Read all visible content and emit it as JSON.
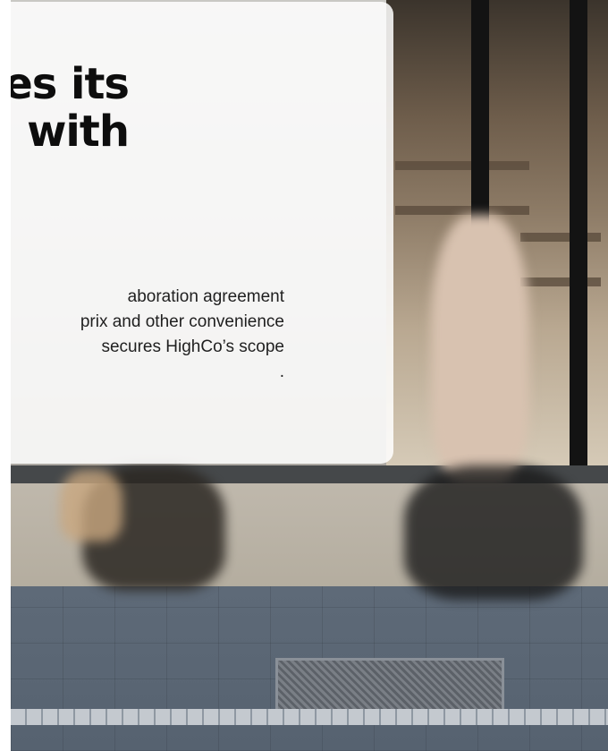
{
  "article": {
    "headline_lines": [
      "es its",
      "with"
    ],
    "body_lines": [
      "aboration agreement",
      "prix and other convenience",
      "secures HighCo’s scope",
      "."
    ]
  },
  "colors": {
    "card_background": "#ffffff",
    "headline": "#0d0d0d",
    "body": "#1f1f1f",
    "paving": "#5e6a78"
  }
}
